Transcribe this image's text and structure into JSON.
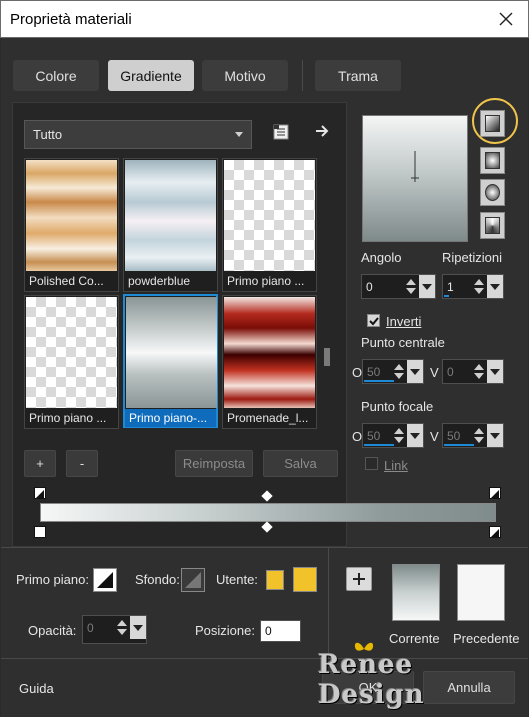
{
  "window": {
    "title": "Proprietà materiali",
    "close_icon": "close-icon"
  },
  "tabs": [
    {
      "label": "Colore",
      "active": false
    },
    {
      "label": "Gradiente",
      "active": true
    },
    {
      "label": "Motivo",
      "active": false
    },
    {
      "label": "Trama",
      "active": false
    }
  ],
  "library": {
    "category": "Tutto",
    "thumbs": [
      {
        "label": "Polished Co...",
        "selected": false
      },
      {
        "label": "powderblue",
        "selected": false
      },
      {
        "label": "Primo piano ...",
        "selected": false
      },
      {
        "label": "Primo piano ...",
        "selected": false
      },
      {
        "label": "Primo piano-...",
        "selected": true
      },
      {
        "label": "Promenade_l...",
        "selected": false
      }
    ],
    "add_label": "+",
    "remove_label": "-",
    "reset_label": "Reimposta",
    "save_label": "Salva"
  },
  "settings": {
    "angle_label": "Angolo",
    "angle_value": "0",
    "repeats_label": "Ripetizioni",
    "repeats_value": "1",
    "invert_label": "Inverti",
    "invert_checked": true,
    "center_label": "Punto centrale",
    "center_o_label": "O",
    "center_o_value": "50",
    "center_v_label": "V",
    "center_v_value": "0",
    "focal_label": "Punto focale",
    "focal_o_label": "O",
    "focal_o_value": "50",
    "focal_v_label": "V",
    "focal_v_value": "50",
    "link_label": "Link",
    "link_checked": false
  },
  "footer": {
    "foreground_label": "Primo piano:",
    "background_label": "Sfondo:",
    "user_label": "Utente:",
    "user_color": "#f2c22a",
    "opacity_label": "Opacità:",
    "opacity_value": "0",
    "position_label": "Posizione:",
    "position_value": "0",
    "current_label": "Corrente",
    "previous_label": "Precedente",
    "help_label": "Guida",
    "ok_label": "OK",
    "cancel_label": "Annulla",
    "watermark": "Renee Design"
  },
  "colors": {
    "accent": "#1e8ad6",
    "highlight": "#f0c44b"
  }
}
